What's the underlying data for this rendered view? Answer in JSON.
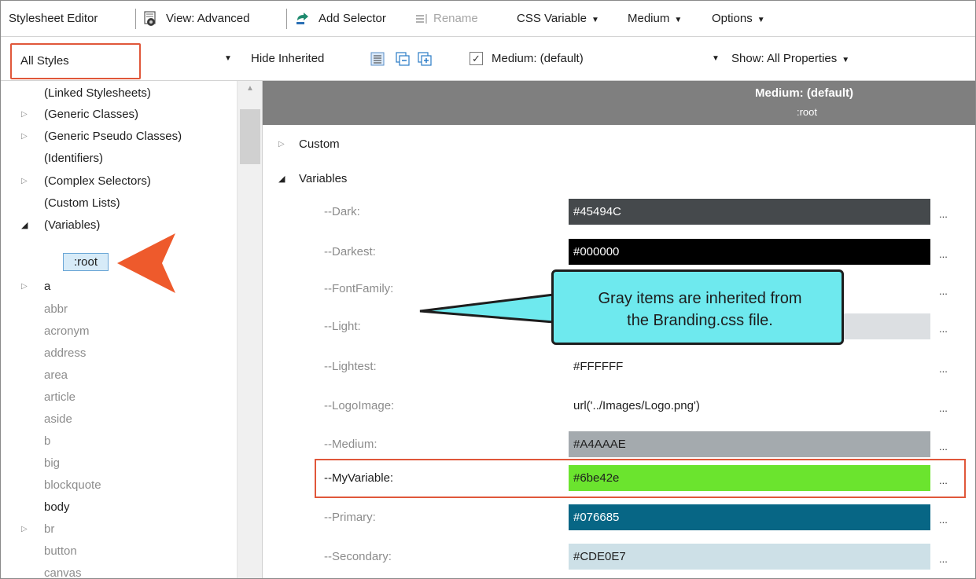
{
  "toolbar": {
    "stylesheet_editor": "Stylesheet Editor",
    "view": "View: Advanced",
    "add_selector": "Add Selector",
    "rename": "Rename",
    "css_variable": "CSS Variable",
    "medium": "Medium",
    "options": "Options"
  },
  "toolbar2": {
    "styles_select": "All Styles",
    "hide_inherited": "Hide Inherited",
    "medium_checkbox": "Medium: (default)",
    "show": "Show: All Properties"
  },
  "tree": {
    "items": [
      {
        "label": "(Linked Stylesheets)",
        "expander": ""
      },
      {
        "label": "(Generic Classes)",
        "expander": "▷"
      },
      {
        "label": "(Generic Pseudo Classes)",
        "expander": "▷"
      },
      {
        "label": "(Identifiers)",
        "expander": ""
      },
      {
        "label": "(Complex Selectors)",
        "expander": "▷"
      },
      {
        "label": "(Custom Lists)",
        "expander": ""
      },
      {
        "label": "(Variables)",
        "expander": "◢"
      },
      {
        "label": ":root",
        "expander": ""
      },
      {
        "label": "a",
        "expander": "▷"
      },
      {
        "label": "abbr",
        "expander": ""
      },
      {
        "label": "acronym",
        "expander": ""
      },
      {
        "label": "address",
        "expander": ""
      },
      {
        "label": "area",
        "expander": ""
      },
      {
        "label": "article",
        "expander": ""
      },
      {
        "label": "aside",
        "expander": ""
      },
      {
        "label": "b",
        "expander": ""
      },
      {
        "label": "big",
        "expander": ""
      },
      {
        "label": "blockquote",
        "expander": ""
      },
      {
        "label": "body",
        "expander": ""
      },
      {
        "label": "br",
        "expander": "▷"
      },
      {
        "label": "button",
        "expander": ""
      },
      {
        "label": "canvas",
        "expander": ""
      }
    ]
  },
  "panel": {
    "medium_title": "Medium: (default)",
    "selector": ":root",
    "custom_section": "Custom",
    "variables_section": "Variables",
    "ellipsis": "...",
    "variables": [
      {
        "name": "--Dark:",
        "value": "#45494C",
        "bg": "#45494c",
        "fg": "#ffffff"
      },
      {
        "name": "--Darkest:",
        "value": "#000000",
        "bg": "#000000",
        "fg": "#ffffff"
      },
      {
        "name": "--FontFamily:",
        "value": "",
        "bg": "",
        "fg": "#1e1e1e"
      },
      {
        "name": "--Light:",
        "value": "",
        "bg": "#dcdfe2",
        "fg": "#1e1e1e"
      },
      {
        "name": "--Lightest:",
        "value": "#FFFFFF",
        "bg": "",
        "fg": "#1e1e1e"
      },
      {
        "name": "--LogoImage:",
        "value": "url('../Images/Logo.png')",
        "bg": "",
        "fg": "#1e1e1e"
      },
      {
        "name": "--Medium:",
        "value": "#A4AAAE",
        "bg": "#a4aaae",
        "fg": "#1e1e1e"
      },
      {
        "name": "--MyVariable:",
        "value": "#6be42e",
        "bg": "#6be42e",
        "fg": "#1e1e1e"
      },
      {
        "name": "--Primary:",
        "value": "#076685",
        "bg": "#076685",
        "fg": "#ffffff"
      },
      {
        "name": "--Secondary:",
        "value": "#CDE0E7",
        "bg": "#cde0e7",
        "fg": "#1e1e1e"
      }
    ]
  },
  "callout": {
    "line1": "Gray items are inherited from",
    "line2": "the Branding.css file."
  },
  "colors": {
    "highlight_border": "#e0573a",
    "callout_fill": "#6ee9ee",
    "arrow_fill": "#ee5a2c",
    "header_band": "#7f7f7f"
  }
}
